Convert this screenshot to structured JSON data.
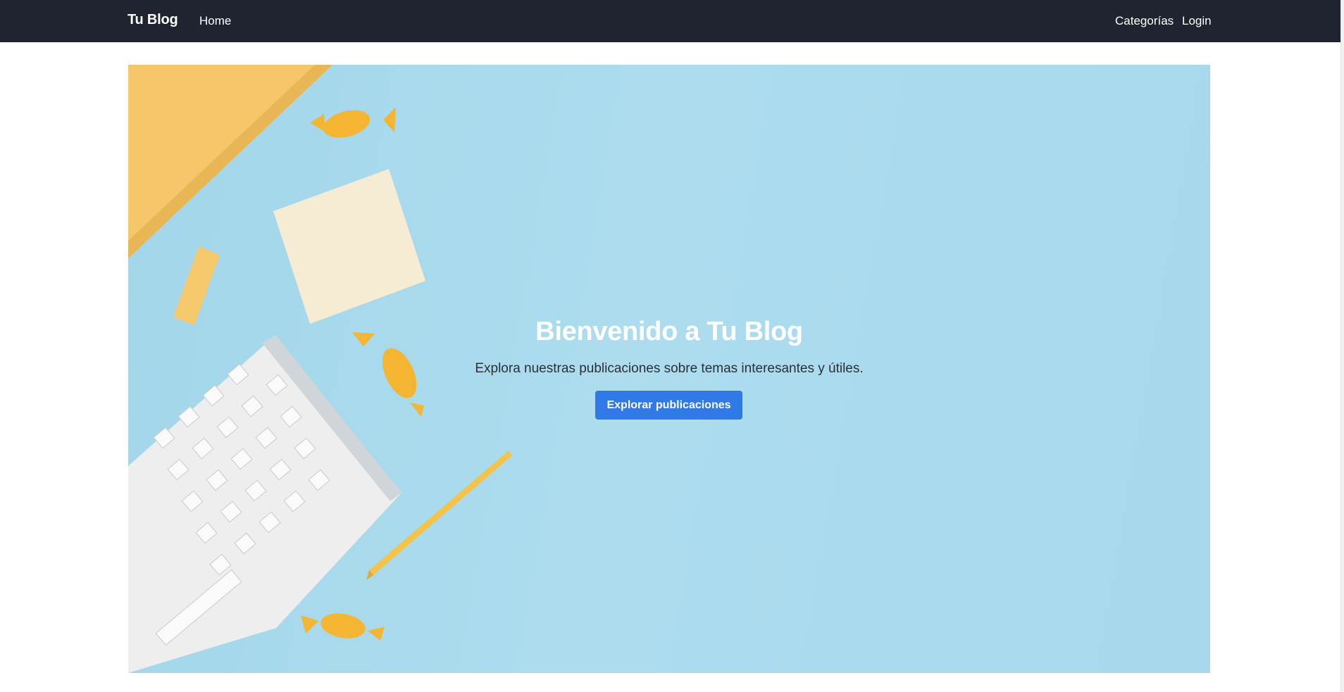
{
  "navbar": {
    "brand": "Tu Blog",
    "home_label": "Home",
    "categorias_label": "Categorías",
    "login_label": "Login"
  },
  "hero": {
    "title": "Bienvenido a Tu Blog",
    "subtitle": "Explora nuestras publicaciones sobre temas interesantes y útiles.",
    "button_label": "Explorar publicaciones"
  },
  "colors": {
    "navbar_bg": "#1f2430",
    "hero_bg": "#a8d8ec",
    "button_bg": "#2f7ae6",
    "ruler": "#f6c76a",
    "candy": "#f4b532",
    "sticky_note": "#f6ecd3",
    "keyboard": "#eeeeee"
  }
}
